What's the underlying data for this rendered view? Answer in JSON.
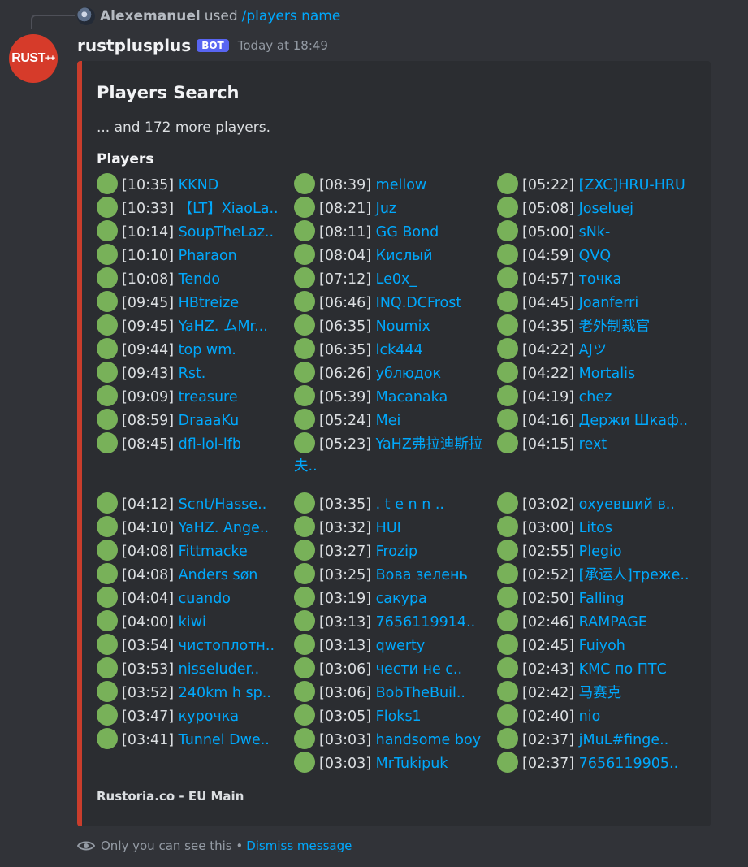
{
  "reply": {
    "user": "Alexemanuel",
    "used_text": "used",
    "command": "/players name"
  },
  "message": {
    "avatar_text": "RUST",
    "avatar_sup": "++",
    "username": "rustplusplus",
    "badge": "BOT",
    "timestamp": "Today at 18:49"
  },
  "embed": {
    "accent_color": "#c93d2c",
    "title": "Players Search",
    "description": "... and 172 more players.",
    "field_name": "Players",
    "status_color": "#78b159",
    "status_icon": "green-circle-icon",
    "columns": [
      [
        {
          "time": "[10:35]",
          "name": "KKND"
        },
        {
          "time": "[10:33]",
          "name": "【LT】XiaoLa.."
        },
        {
          "time": "[10:14]",
          "name": "SoupTheLaz.."
        },
        {
          "time": "[10:10]",
          "name": "Pharaon"
        },
        {
          "time": "[10:08]",
          "name": "Tendo"
        },
        {
          "time": "[09:45]",
          "name": "HBtreize"
        },
        {
          "time": "[09:45]",
          "name": "YaHZ. ムMr..."
        },
        {
          "time": "[09:44]",
          "name": "top wm."
        },
        {
          "time": "[09:43]",
          "name": "Rst."
        },
        {
          "time": "[09:09]",
          "name": "treasure"
        },
        {
          "time": "[08:59]",
          "name": "DraaaKu"
        },
        {
          "time": "[08:45]",
          "name": "dfl-lol-lfb"
        }
      ],
      [
        {
          "time": "[08:39]",
          "name": "mellow"
        },
        {
          "time": "[08:21]",
          "name": "Juz"
        },
        {
          "time": "[08:11]",
          "name": "GG Bond"
        },
        {
          "time": "[08:04]",
          "name": "Кислый"
        },
        {
          "time": "[07:12]",
          "name": "Le0x_"
        },
        {
          "time": "[06:46]",
          "name": "INQ.DCFrost"
        },
        {
          "time": "[06:35]",
          "name": "Noumix"
        },
        {
          "time": "[06:35]",
          "name": "lck444"
        },
        {
          "time": "[06:26]",
          "name": "ублюдок"
        },
        {
          "time": "[05:39]",
          "name": "Macanaka"
        },
        {
          "time": "[05:24]",
          "name": "Mei"
        },
        {
          "time": "[05:23]",
          "name": "YaHZ弗拉迪斯拉夫.."
        }
      ],
      [
        {
          "time": "[05:22]",
          "name": "[ZXC]HRU-HRU"
        },
        {
          "time": "[05:08]",
          "name": "Joseluej"
        },
        {
          "time": "[05:00]",
          "name": "sNk-"
        },
        {
          "time": "[04:59]",
          "name": "QVQ"
        },
        {
          "time": "[04:57]",
          "name": "точка"
        },
        {
          "time": "[04:45]",
          "name": "Joanferri"
        },
        {
          "time": "[04:35]",
          "name": "老外制裁官"
        },
        {
          "time": "[04:22]",
          "name": "AJツ"
        },
        {
          "time": "[04:22]",
          "name": "Mortalis"
        },
        {
          "time": "[04:19]",
          "name": "chez"
        },
        {
          "time": "[04:16]",
          "name": "Держи Шкаф.."
        },
        {
          "time": "[04:15]",
          "name": "rext"
        }
      ],
      [
        {
          "time": "[04:12]",
          "name": "Scnt/Hasse.."
        },
        {
          "time": "[04:10]",
          "name": "YaHZ. Ange.."
        },
        {
          "time": "[04:08]",
          "name": "Fittmacke"
        },
        {
          "time": "[04:08]",
          "name": "Anders søn"
        },
        {
          "time": "[04:04]",
          "name": "cuando"
        },
        {
          "time": "[04:00]",
          "name": "kiwi"
        },
        {
          "time": "[03:54]",
          "name": "чистоплотн.."
        },
        {
          "time": "[03:53]",
          "name": "nisseluder.."
        },
        {
          "time": "[03:52]",
          "name": "240km h sp.."
        },
        {
          "time": "[03:47]",
          "name": "курочка"
        },
        {
          "time": "[03:41]",
          "name": "Tunnel Dwe.."
        }
      ],
      [
        {
          "time": "[03:35]",
          "name": ". t e n n .."
        },
        {
          "time": "[03:32]",
          "name": "HUI"
        },
        {
          "time": "[03:27]",
          "name": "Frozip"
        },
        {
          "time": "[03:25]",
          "name": "Вова зелень"
        },
        {
          "time": "[03:19]",
          "name": "сакура"
        },
        {
          "time": "[03:13]",
          "name": "7656119914.."
        },
        {
          "time": "[03:13]",
          "name": "qwerty"
        },
        {
          "time": "[03:06]",
          "name": "чести не с.."
        },
        {
          "time": "[03:06]",
          "name": "BobTheBuil.."
        },
        {
          "time": "[03:05]",
          "name": "Floks1"
        },
        {
          "time": "[03:03]",
          "name": "handsome boy"
        },
        {
          "time": "[03:03]",
          "name": "MrTukipuk"
        }
      ],
      [
        {
          "time": "[03:02]",
          "name": "охуевший в.."
        },
        {
          "time": "[03:00]",
          "name": "Litos"
        },
        {
          "time": "[02:55]",
          "name": "Plegio"
        },
        {
          "time": "[02:52]",
          "name": "[承运人]треже.."
        },
        {
          "time": "[02:50]",
          "name": "Falling"
        },
        {
          "time": "[02:46]",
          "name": "RAMPAGE"
        },
        {
          "time": "[02:45]",
          "name": "Fuiyoh"
        },
        {
          "time": "[02:43]",
          "name": "KMC по ПТС"
        },
        {
          "time": "[02:42]",
          "name": "马赛克"
        },
        {
          "time": "[02:40]",
          "name": "nio"
        },
        {
          "time": "[02:37]",
          "name": "jMuL#finge.."
        },
        {
          "time": "[02:37]",
          "name": "7656119905.."
        }
      ]
    ],
    "footer": "Rustoria.co - EU Main"
  },
  "ephemeral": {
    "icon": "eye-icon",
    "text": "Only you can see this •",
    "dismiss": "Dismiss message"
  }
}
